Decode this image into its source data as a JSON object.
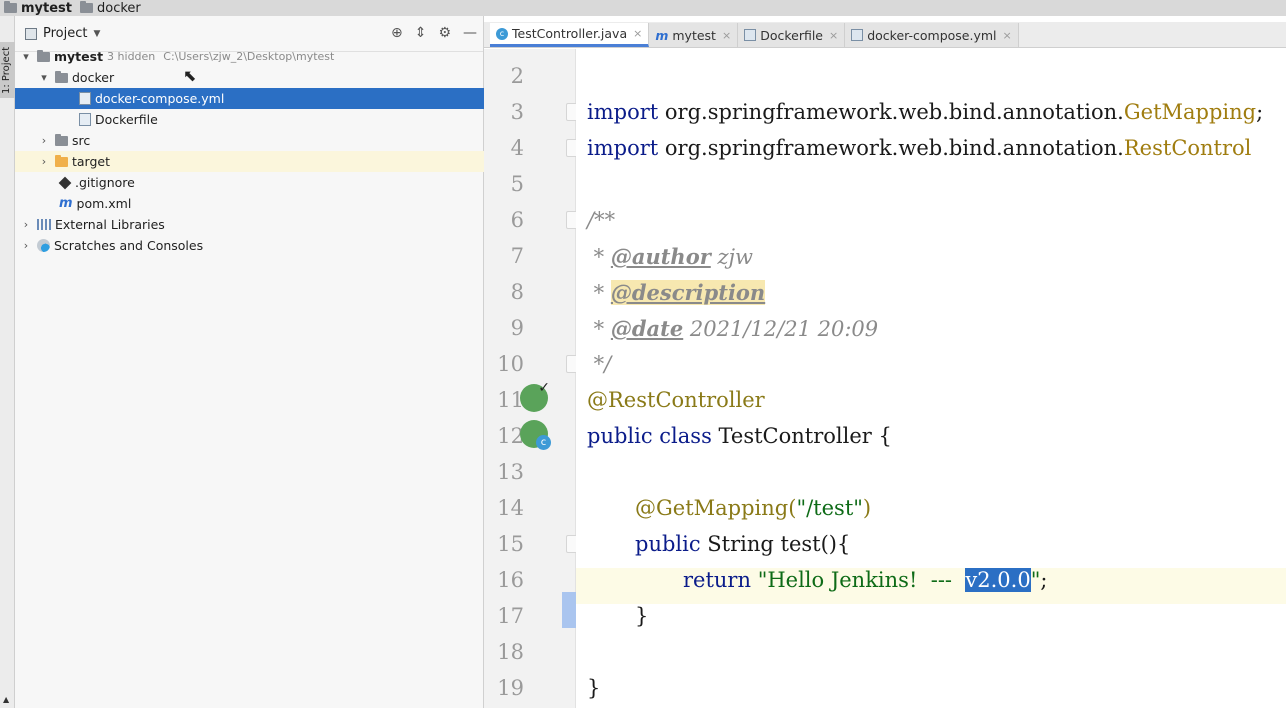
{
  "breadcrumb": {
    "project": "mytest",
    "folder": "docker"
  },
  "tool_strip": {
    "project_tab": "1: Project"
  },
  "project_panel": {
    "title": "Project",
    "tree": [
      {
        "label": "mytest",
        "hint": "3 hidden",
        "path": "C:\\Users\\zjw_2\\Desktop\\mytest"
      },
      {
        "label": "docker"
      },
      {
        "label": "docker-compose.yml"
      },
      {
        "label": "Dockerfile"
      },
      {
        "label": "src"
      },
      {
        "label": "target"
      },
      {
        "label": ".gitignore"
      },
      {
        "label": "pom.xml"
      },
      {
        "label": "External Libraries"
      },
      {
        "label": "Scratches and Consoles"
      }
    ]
  },
  "editor": {
    "tabs": [
      {
        "label": "TestController.java",
        "active": true
      },
      {
        "label": "mytest"
      },
      {
        "label": "Dockerfile"
      },
      {
        "label": "docker-compose.yml"
      }
    ],
    "line_numbers": [
      "2",
      "3",
      "4",
      "5",
      "6",
      "7",
      "8",
      "9",
      "10",
      "11",
      "12",
      "13",
      "14",
      "15",
      "16",
      "17",
      "18",
      "19"
    ],
    "code": {
      "import_kw": "import",
      "import1_pkg": "org.springframework.web.bind.annotation.",
      "import1_cls": "GetMapping",
      "import1_end": ";",
      "import2_pkg": "org.springframework.web.bind.annotation.",
      "import2_cls": "RestControl",
      "doc_open": "/**",
      "star": " * ",
      "author_tag": "@author",
      "author_val": " zjw",
      "desc_tag": "@description",
      "date_tag": "@date",
      "date_val": " 2021/12/21 20:09",
      "doc_close": " */",
      "rest_ann": "@RestController",
      "public_kw": "public",
      "class_kw": "class",
      "class_name": " TestController {",
      "get_ann": "@GetMapping(",
      "get_path": "\"/test\"",
      "get_close": ")",
      "method_rest": " String test(){",
      "return_kw": "return",
      "str_start": "\"Hello Jenkins!  ---  ",
      "str_selected": "v2.0.0",
      "str_end": "\"",
      "semicolon": ";",
      "brace_close_inner": "}",
      "brace_close_outer": "}"
    }
  }
}
